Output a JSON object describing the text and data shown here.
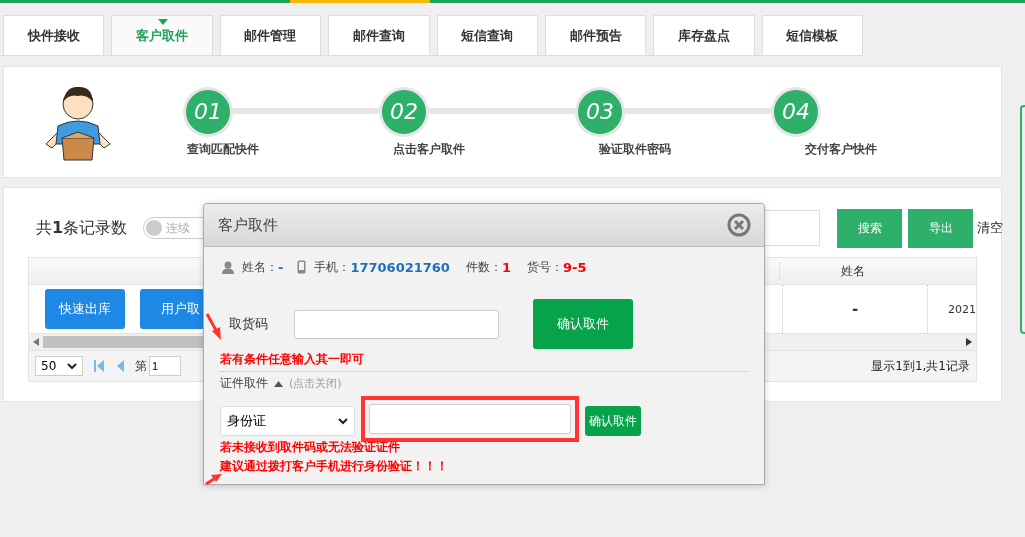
{
  "tabs": [
    {
      "label": "快件接收",
      "selected": false
    },
    {
      "label": "客户取件",
      "selected": true
    },
    {
      "label": "邮件管理",
      "selected": false
    },
    {
      "label": "邮件查询",
      "selected": false
    },
    {
      "label": "短信查询",
      "selected": false
    },
    {
      "label": "邮件预告",
      "selected": false
    },
    {
      "label": "库存盘点",
      "selected": false
    },
    {
      "label": "短信模板",
      "selected": false
    }
  ],
  "steps": [
    {
      "number": "01",
      "label": "查询匹配快件"
    },
    {
      "number": "02",
      "label": "点击客户取件"
    },
    {
      "number": "03",
      "label": "验证取件密码"
    },
    {
      "number": "04",
      "label": "交付客户快件"
    }
  ],
  "records": {
    "count_label": "共**1**条记录数",
    "toggle_label": "连续",
    "on": false
  },
  "toolbar": {
    "buttons": [
      "搜索",
      "导出"
    ],
    "clear": "清空"
  },
  "table": {
    "columns": [
      "姓名"
    ],
    "row": {
      "actions": [
        "快速出库",
        "用户取"
      ],
      "name": "-",
      "column_3": "2021"
    }
  },
  "pager": {
    "page_size": "50",
    "page_label": "第",
    "page": "1",
    "summary": "显示1到1,共1记录"
  },
  "dialog": {
    "title": "客户取件",
    "info": [
      {
        "kind": "person",
        "label": "姓名：",
        "value": "-",
        "color": "#1e6fc0"
      },
      {
        "kind": "phone",
        "label": "手机：",
        "value": "17706021760",
        "color": "#1e6fc0"
      },
      {
        "kind": "plain",
        "label": "件数：",
        "value": "1",
        "color": "#ff0000"
      },
      {
        "kind": "plain",
        "label": "货号：",
        "value": "9-5",
        "color": "#ff0000"
      }
    ],
    "code_label": "取货码",
    "confirm": "确认取件",
    "hint": "若有条件任意输入其一即可",
    "id_section": {
      "title": "证件取件",
      "expanded": true,
      "toggle_hint": "(点击关闭)",
      "id_type": "身份证",
      "confirm": "确认取件",
      "warnings": [
        "若未接收到取件码或无法验证证件",
        "建议通过拨打客户手机进行身份验证！！！"
      ]
    }
  }
}
